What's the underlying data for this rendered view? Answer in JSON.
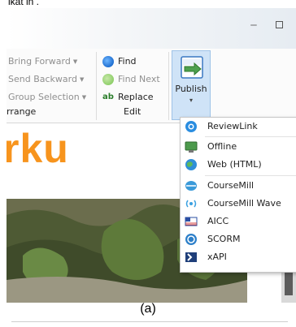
{
  "top_caption": "ikat in .",
  "window": {
    "minimize_glyph": "‒",
    "maximize_glyph": ""
  },
  "ribbon": {
    "arrange": {
      "bring_forward": "Bring Forward",
      "send_backward": "Send Backward",
      "group_selection": "Group Selection",
      "group_label": "rrange"
    },
    "edit": {
      "find": "Find",
      "find_next": "Find Next",
      "replace": "Replace",
      "group_label": "Edit"
    },
    "publish": {
      "label": "Publish",
      "caret": "▾"
    }
  },
  "canvas": {
    "big_text": "rku",
    "big_text_color": "#f7941d"
  },
  "publish_menu": {
    "items": [
      {
        "label": "ReviewLink",
        "icon": "reviewlink-icon"
      },
      {
        "label": "Offline",
        "icon": "offline-icon"
      },
      {
        "label": "Web (HTML)",
        "icon": "web-globe-icon"
      },
      {
        "label": "CourseMill",
        "icon": "coursemill-icon"
      },
      {
        "label": "CourseMill Wave",
        "icon": "coursemill-wave-icon"
      },
      {
        "label": "AICC",
        "icon": "aicc-icon"
      },
      {
        "label": "SCORM",
        "icon": "scorm-icon"
      },
      {
        "label": "xAPI",
        "icon": "xapi-icon"
      }
    ]
  },
  "caption": "(a)",
  "colors": {
    "accent_blue": "#1f6fd1",
    "publish_bg": "#cfe3f7",
    "orange_text": "#f7941d"
  }
}
